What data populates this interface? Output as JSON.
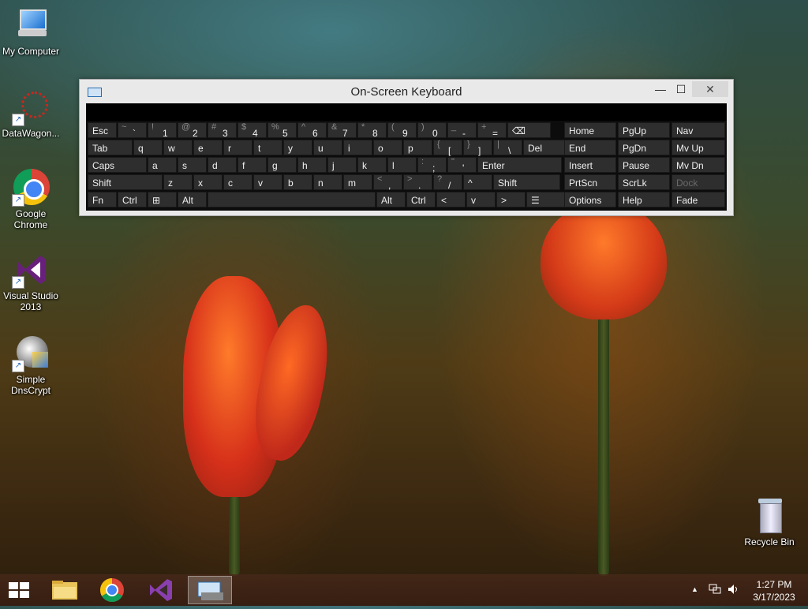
{
  "desktop": {
    "icons": [
      {
        "label": "My Computer"
      },
      {
        "label": "DataWagon..."
      },
      {
        "label": "Google Chrome"
      },
      {
        "label": "Visual Studio 2013"
      },
      {
        "label": "Simple DnsCrypt"
      },
      {
        "label": "Recycle Bin"
      }
    ]
  },
  "osk": {
    "title": "On-Screen Keyboard",
    "minimize": "—",
    "maximize": "☐",
    "close": "✕",
    "rows": [
      [
        {
          "main": "Esc"
        },
        {
          "top": "~",
          "bot": "`"
        },
        {
          "top": "!",
          "bot": "1"
        },
        {
          "top": "@",
          "bot": "2"
        },
        {
          "top": "#",
          "bot": "3"
        },
        {
          "top": "$",
          "bot": "4"
        },
        {
          "top": "%",
          "bot": "5"
        },
        {
          "top": "^",
          "bot": "6"
        },
        {
          "top": "&",
          "bot": "7"
        },
        {
          "top": "*",
          "bot": "8"
        },
        {
          "top": "(",
          "bot": "9"
        },
        {
          "top": ")",
          "bot": "0"
        },
        {
          "top": "_",
          "bot": "-"
        },
        {
          "top": "+",
          "bot": "="
        },
        {
          "main": "⌫"
        }
      ],
      [
        {
          "main": "Tab"
        },
        {
          "main": "q"
        },
        {
          "main": "w"
        },
        {
          "main": "e"
        },
        {
          "main": "r"
        },
        {
          "main": "t"
        },
        {
          "main": "y"
        },
        {
          "main": "u"
        },
        {
          "main": "i"
        },
        {
          "main": "o"
        },
        {
          "main": "p"
        },
        {
          "top": "{",
          "bot": "["
        },
        {
          "top": "}",
          "bot": "]"
        },
        {
          "top": "|",
          "bot": "\\"
        },
        {
          "main": "Del"
        }
      ],
      [
        {
          "main": "Caps"
        },
        {
          "main": "a"
        },
        {
          "main": "s"
        },
        {
          "main": "d"
        },
        {
          "main": "f"
        },
        {
          "main": "g"
        },
        {
          "main": "h"
        },
        {
          "main": "j"
        },
        {
          "main": "k"
        },
        {
          "main": "l"
        },
        {
          "top": ":",
          "bot": ";"
        },
        {
          "top": "\"",
          "bot": "'"
        },
        {
          "main": "Enter"
        }
      ],
      [
        {
          "main": "Shift"
        },
        {
          "main": "z"
        },
        {
          "main": "x"
        },
        {
          "main": "c"
        },
        {
          "main": "v"
        },
        {
          "main": "b"
        },
        {
          "main": "n"
        },
        {
          "main": "m"
        },
        {
          "top": "<",
          "bot": ","
        },
        {
          "top": ">",
          "bot": "."
        },
        {
          "top": "?",
          "bot": "/"
        },
        {
          "main": "^"
        },
        {
          "main": "Shift"
        }
      ],
      [
        {
          "main": "Fn"
        },
        {
          "main": "Ctrl"
        },
        {
          "main": "⊞"
        },
        {
          "main": "Alt"
        },
        {
          "main": ""
        },
        {
          "main": "Alt"
        },
        {
          "main": "Ctrl"
        },
        {
          "main": "<"
        },
        {
          "main": "v"
        },
        {
          "main": ">"
        },
        {
          "main": "☰"
        }
      ]
    ],
    "nav": [
      [
        "Home",
        "PgUp",
        "Nav"
      ],
      [
        "End",
        "PgDn",
        "Mv Up"
      ],
      [
        "Insert",
        "Pause",
        "Mv Dn"
      ],
      [
        "PrtScn",
        "ScrLk",
        "Dock"
      ],
      [
        "Options",
        "Help",
        "Fade"
      ]
    ]
  },
  "taskbar": {
    "items": [
      "Start",
      "File Explorer",
      "Google Chrome",
      "Visual Studio",
      "On-Screen Keyboard"
    ],
    "tray_up": "▲",
    "time": "1:27 PM",
    "date": "3/17/2023"
  }
}
